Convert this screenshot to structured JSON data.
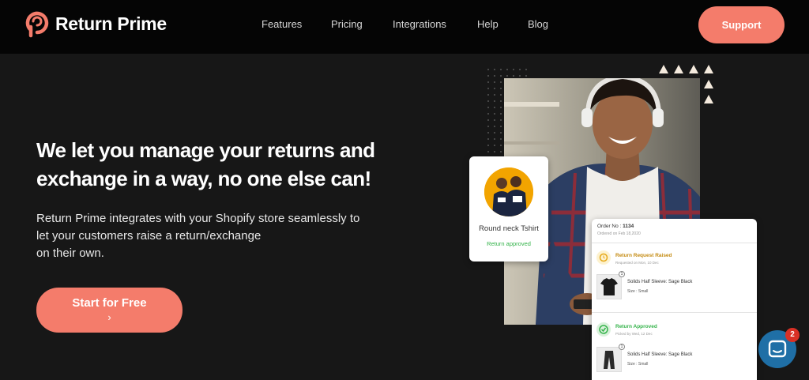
{
  "header": {
    "brand": "Return Prime",
    "nav": [
      "Features",
      "Pricing",
      "Integrations",
      "Help",
      "Blog"
    ],
    "support_label": "Support"
  },
  "hero": {
    "headline_line1": "We let you manage your returns and",
    "headline_line2": "exchange in a way, no one else can!",
    "sub_line1": "Return Prime integrates with your Shopify store seamlessly to",
    "sub_line2": "let your customers raise a return/exchange",
    "sub_line3": "on their own.",
    "cta_label": "Start for Free",
    "cta_chevron": "›"
  },
  "product_card": {
    "name": "Round neck Tshirt",
    "status": "Return approved"
  },
  "order_card": {
    "order_label": "Order No :",
    "order_number": "1134",
    "ordered_on": "Ordered on Feb 18,2020",
    "steps": [
      {
        "title": "Return Request Raised",
        "subtitle": "Requested on Mon, 10 Dec",
        "quantity": "1",
        "item_name": "Solids Half Sleeve: Sage Black",
        "item_size": "Size : Small"
      },
      {
        "title": "Return Approved",
        "subtitle": "Picked by Wed, 12 Dec",
        "quantity": "1",
        "item_name": "Solids Half Sleeve: Sage Black",
        "item_size": "Size : Small"
      }
    ]
  },
  "chat": {
    "badge_count": "2"
  },
  "colors": {
    "accent": "#f47c6b",
    "background": "#171717",
    "header": "#050505",
    "success": "#34b34a",
    "pending": "#e6a817",
    "chat": "#1f6fa6",
    "badge": "#d93025"
  },
  "icons": [
    "return-prime-logo-icon",
    "chevron-right-icon",
    "clock-icon",
    "check-circle-icon",
    "tshirt-icon",
    "pants-icon",
    "chat-icon"
  ]
}
